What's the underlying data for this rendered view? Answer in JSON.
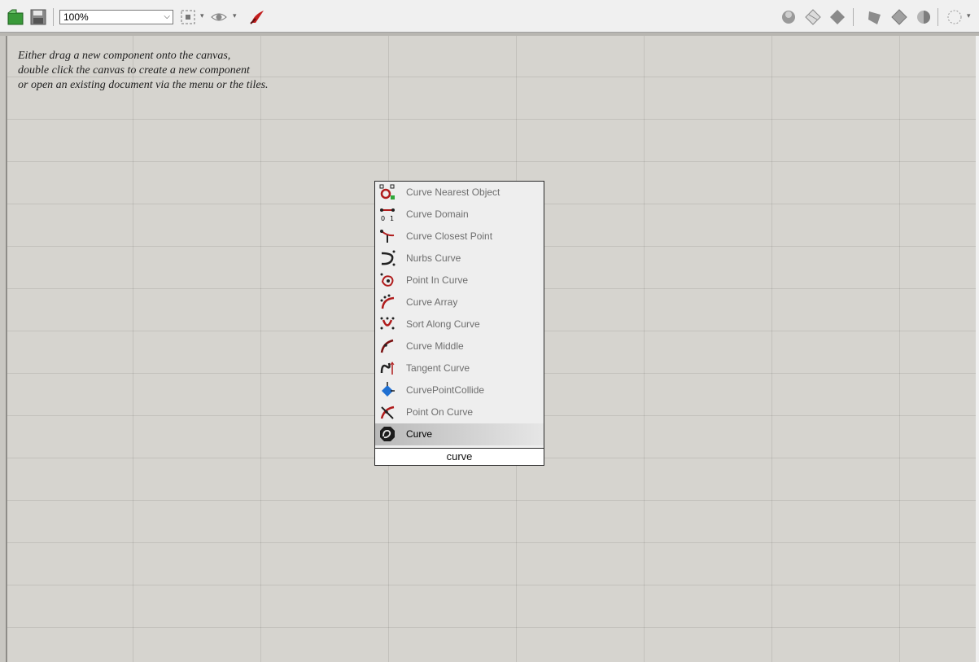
{
  "toolbar": {
    "zoom": "100%",
    "left_icons": [
      "open-file-icon",
      "save-icon",
      "zoom-extents-icon",
      "preview-eye-icon",
      "sketch-brush-icon"
    ],
    "right_icons": [
      "preview-wireframe-icon",
      "preview-shaded-icon",
      "preview-selected-icon",
      "render-mesh-icon",
      "render-shaded-icon",
      "render-material-icon",
      "render-settings-icon"
    ]
  },
  "canvas": {
    "hint_lines": [
      "Either drag a new component onto the canvas,",
      "double click the canvas to create a new component",
      "or open an existing document via the menu or the tiles."
    ]
  },
  "search_popup": {
    "items": [
      {
        "label": "Curve Nearest Object",
        "icon": "curve-nearest-object-icon"
      },
      {
        "label": "Curve Domain",
        "icon": "curve-domain-icon"
      },
      {
        "label": "Curve Closest Point",
        "icon": "curve-closest-point-icon"
      },
      {
        "label": "Nurbs Curve",
        "icon": "nurbs-curve-icon"
      },
      {
        "label": "Point In Curve",
        "icon": "point-in-curve-icon"
      },
      {
        "label": "Curve Array",
        "icon": "curve-array-icon"
      },
      {
        "label": "Sort Along Curve",
        "icon": "sort-along-curve-icon"
      },
      {
        "label": "Curve Middle",
        "icon": "curve-middle-icon"
      },
      {
        "label": "Tangent Curve",
        "icon": "tangent-curve-icon"
      },
      {
        "label": "CurvePointCollide",
        "icon": "curve-point-collide-icon"
      },
      {
        "label": "Point On Curve",
        "icon": "point-on-curve-icon"
      },
      {
        "label": "Curve",
        "icon": "curve-param-icon",
        "selected": true
      }
    ],
    "query": "curve"
  }
}
